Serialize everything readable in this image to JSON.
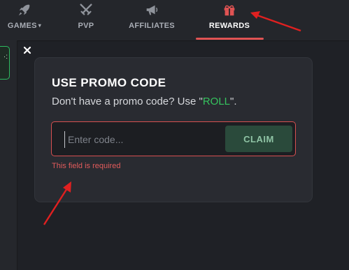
{
  "nav": {
    "games": {
      "label": "GAMES",
      "caret": "▾",
      "icon": "rocket-icon"
    },
    "pvp": {
      "label": "PVP",
      "icon": "crossed-swords-icon"
    },
    "affiliates": {
      "label": "AFFILIATES",
      "icon": "megaphone-icon"
    },
    "rewards": {
      "label": "REWARDS",
      "icon": "gift-icon",
      "active": true
    }
  },
  "side": {
    "button_text": "·:"
  },
  "modal": {
    "title": "USE PROMO CODE",
    "subtitle_prefix": "Don't have a promo code? Use \"",
    "promo_code": "ROLL",
    "subtitle_suffix": "\".",
    "input_placeholder": "Enter code...",
    "input_value": "",
    "claim_label": "CLAIM",
    "error": "This field is required"
  },
  "colors": {
    "accent_red": "#e05353",
    "promo_green": "#35c35e",
    "claim_bg": "#2a4a3b"
  }
}
